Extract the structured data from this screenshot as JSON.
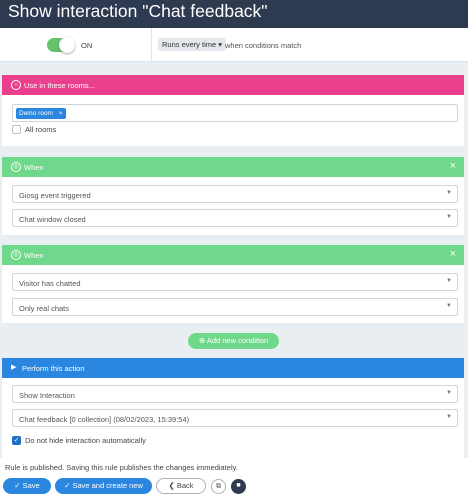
{
  "window": {
    "title": "Show interaction \"Chat feedback\""
  },
  "top": {
    "toggle_label": "ON",
    "runs_select": "Runs every time ▾",
    "runs_suffix": "when conditions match"
  },
  "rooms": {
    "header": "Use in these rooms...",
    "chip": "Demo room",
    "chip_remove": "×",
    "all_rooms_label": "All rooms"
  },
  "conditions": [
    {
      "header": "When",
      "close": "×",
      "field1": "Giosg event triggered",
      "field2": "Chat window closed"
    },
    {
      "header": "When",
      "close": "×",
      "field1": "Visitor has chatted",
      "field2": "Only real chats"
    }
  ],
  "add_condition_label": "Add new condition",
  "action": {
    "header": "Perform this action",
    "field1": "Show Interaction",
    "field2": "Chat feedback [0 collection] (08/02/2023, 15:39:54)",
    "checkbox_label": "Do not hide interaction automatically",
    "checkbox_checked": true
  },
  "footer": {
    "message": "Rule is published. Saving this rule publishes the changes immediately.",
    "save": "Save",
    "save_new": "Save and create new",
    "back": "Back"
  },
  "colors": {
    "titlebar": "#2d3a4f",
    "pink": "#e93f8c",
    "green": "#6fd88a",
    "blue": "#2b86e0"
  }
}
